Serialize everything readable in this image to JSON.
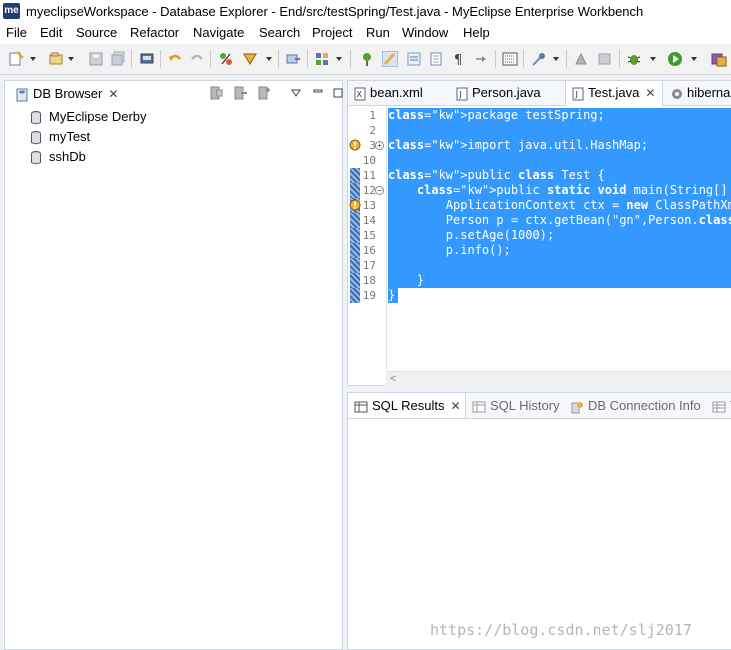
{
  "window": {
    "app_badge": "me",
    "title": "myeclipseWorkspace - Database Explorer - End/src/testSpring/Test.java - MyEclipse Enterprise Workbench"
  },
  "menu": [
    "File",
    "Edit",
    "Source",
    "Refactor",
    "Navigate",
    "Search",
    "Project",
    "Run",
    "Window",
    "Help"
  ],
  "toolbar_icons": [
    "new-wizard-icon",
    "new-project-icon",
    "save-icon",
    "save-all-icon",
    "print-icon",
    "undo-icon",
    "redo-icon",
    "spring-icon",
    "deploy-icon",
    "open-type-icon",
    "perspective-grid-icon",
    "pin-icon",
    "highlight-icon",
    "toggle-mark-icon",
    "open-file-icon",
    "format-icon",
    "show-whitespace-icon",
    "open-console-icon",
    "build-icon",
    "history-icon",
    "debug-icon",
    "run-icon",
    "external-tools-icon"
  ],
  "db_browser": {
    "tab_label": "DB Browser",
    "items": [
      "MyEclipse Derby",
      "myTest",
      "sshDb"
    ]
  },
  "editor": {
    "tabs": [
      "bean.xml",
      "Person.java",
      "Test.java",
      "hiberna"
    ],
    "active_tab": "Test.java",
    "lines": [
      {
        "n": "1",
        "text": "package testSpring;"
      },
      {
        "n": "2",
        "text": ""
      },
      {
        "n": "3",
        "text": "import java.util.HashMap;"
      },
      {
        "n": "10",
        "text": ""
      },
      {
        "n": "11",
        "text": "public class Test {"
      },
      {
        "n": "12",
        "text": "    public static void main(String[] args){"
      },
      {
        "n": "13",
        "text": "        ApplicationContext ctx = new ClassPathXml"
      },
      {
        "n": "14",
        "text": "        Person p = ctx.getBean(\"gn\",Person.class)"
      },
      {
        "n": "15",
        "text": "        p.setAge(1000);"
      },
      {
        "n": "16",
        "text": "        p.info();"
      },
      {
        "n": "17",
        "text": ""
      },
      {
        "n": "18",
        "text": "    }"
      },
      {
        "n": "19",
        "text": "}"
      }
    ]
  },
  "bottom_panel": {
    "tabs": [
      "SQL Results",
      "SQL History",
      "DB Connection Info",
      "T"
    ],
    "active_tab": "SQL Results"
  },
  "watermark": "https://blog.csdn.net/slj2017",
  "colors": {
    "selection": "#3399ff",
    "app_badge": "#1f3f73",
    "warning": "#e8b03c"
  }
}
